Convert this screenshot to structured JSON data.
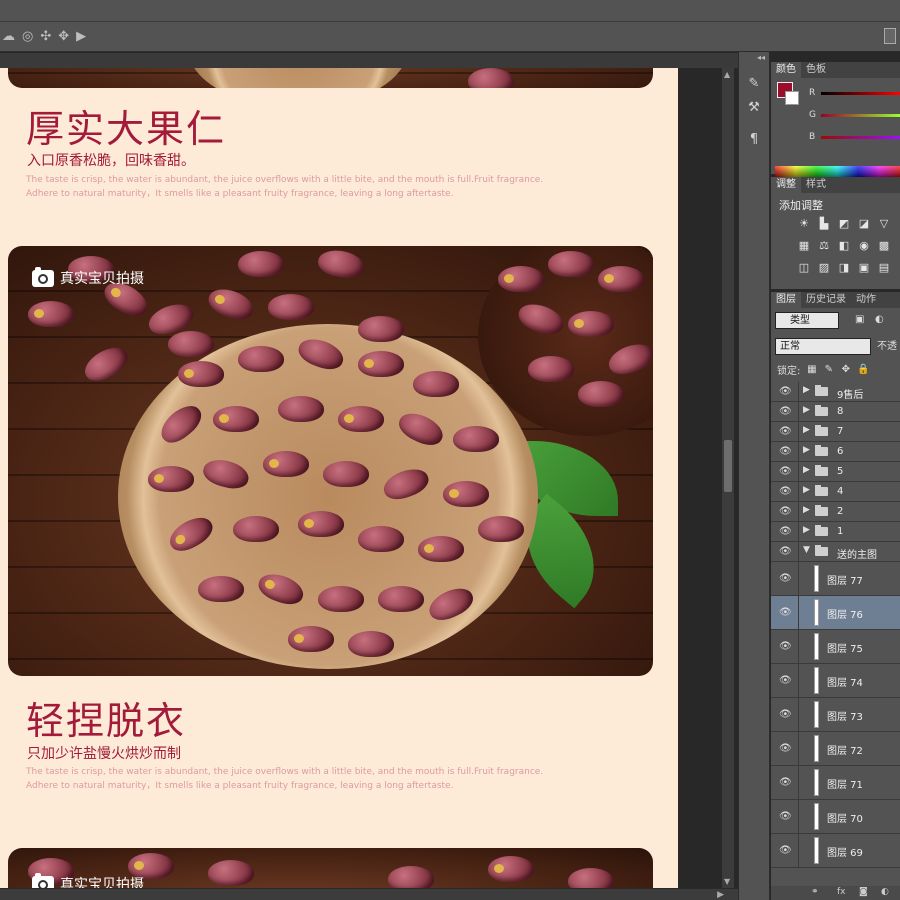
{
  "toolbar_icons": [
    "cloud-icon",
    "target-icon",
    "crosshair-icon",
    "move-icon",
    "video-icon"
  ],
  "canvas": {
    "badge": "真实宝贝拍摄",
    "section1": {
      "title": "厚实大果仁",
      "subtitle": "入口原香松脆，回味香甜。",
      "en1": "The taste is crisp, the water is abundant, the juice overflows with a little bite, and the mouth is full.Fruit fragrance.",
      "en2": "Adhere to natural maturity，It smells like a pleasant fruity fragrance, leaving a long aftertaste."
    },
    "section2": {
      "title": "轻捏脱衣",
      "subtitle": "只加少许盐慢火烘炒而制",
      "en1": "The taste is crisp, the water is abundant, the juice overflows with a little bite, and the mouth is full.Fruit fragrance.",
      "en2": "Adhere to natural maturity，It smells like a pleasant fruity fragrance, leaving a long aftertaste."
    }
  },
  "color_panel": {
    "tabs": [
      "颜色",
      "色板"
    ],
    "labels": [
      "R",
      "G",
      "B"
    ],
    "fg_color": "#9b0d2b"
  },
  "adjust_panel": {
    "tabs": [
      "调整",
      "样式"
    ],
    "title": "添加调整"
  },
  "layers_panel": {
    "tabs": [
      "图层",
      "历史记录",
      "动作"
    ],
    "kind": "类型",
    "blend": "正常",
    "opacity": "不透",
    "lock": "锁定:",
    "groups": [
      "9售后",
      "8",
      "7",
      "6",
      "5",
      "4",
      "2",
      "1"
    ],
    "open_group": "送的主图",
    "layers": [
      "图层 77",
      "图层 76",
      "图层 75",
      "图层 74",
      "图层 73",
      "图层 72",
      "图层 71",
      "图层 70",
      "图层 69"
    ],
    "selected": "图层 76"
  }
}
